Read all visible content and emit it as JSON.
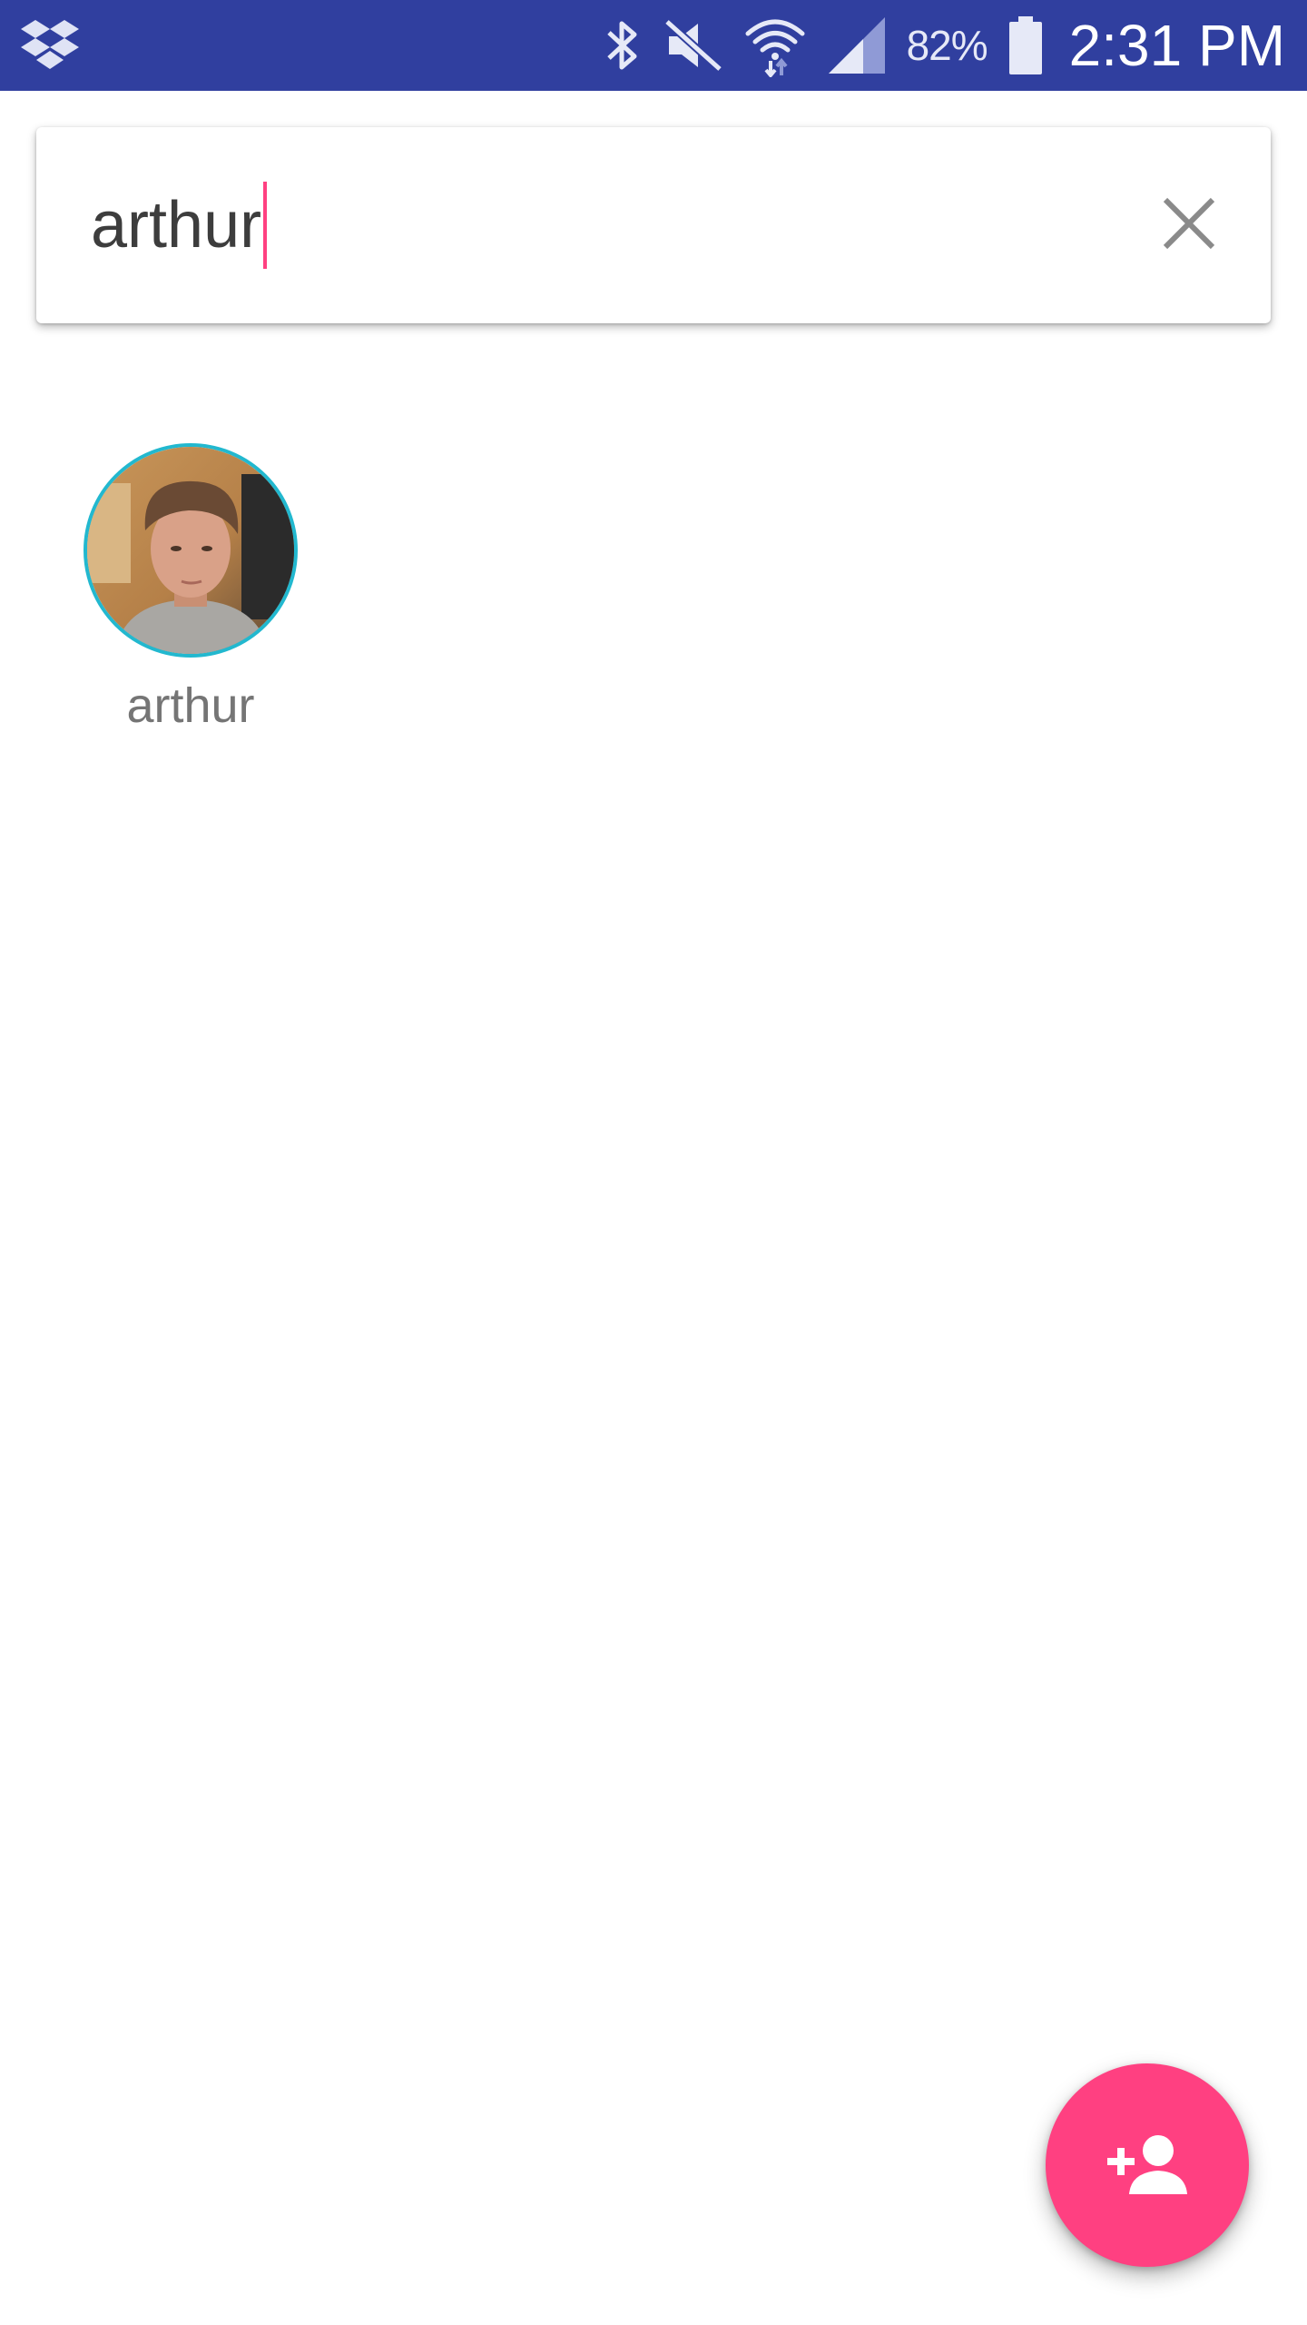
{
  "status_bar": {
    "background": "#303f9f",
    "left_icon": "dropbox-icon",
    "icons": [
      "bluetooth-icon",
      "mute-icon",
      "wifi-icon",
      "signal-icon"
    ],
    "battery_percent": "82%",
    "battery_icon": "battery-icon",
    "time": "2:31 PM"
  },
  "search": {
    "value": "arthur",
    "clear_icon": "close-icon",
    "caret_color": "#ff4081"
  },
  "results": [
    {
      "name": "arthur",
      "avatar_icon": "avatar",
      "ring_color": "#22b8cf"
    }
  ],
  "fab": {
    "icon": "add-person-icon",
    "color": "#ff4081"
  }
}
